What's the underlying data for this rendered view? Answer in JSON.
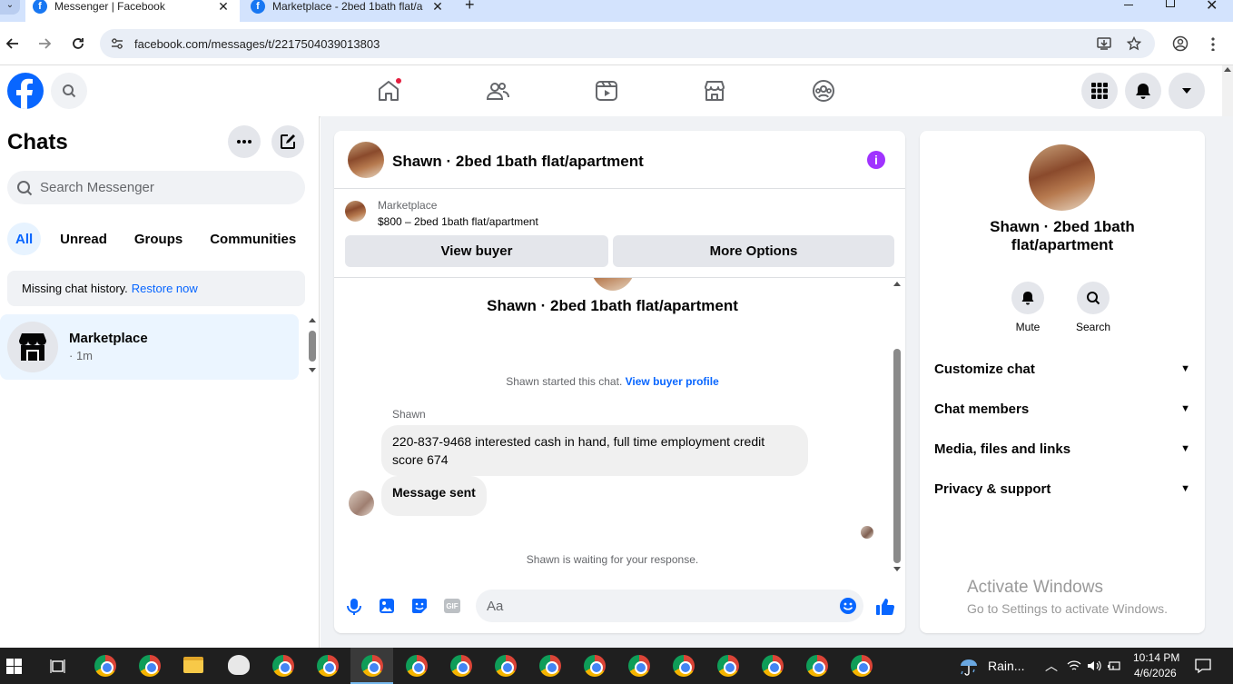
{
  "browser": {
    "tabs": [
      {
        "title": "Messenger | Facebook",
        "active": true
      },
      {
        "title": "Marketplace - 2bed 1bath flat/a",
        "active": false
      }
    ],
    "new_tab": "+",
    "url": "facebook.com/messages/t/2217504039013803"
  },
  "fb_header": {
    "nav_icons": [
      "home-icon",
      "friends-icon",
      "video-icon",
      "marketplace-icon",
      "groups-icon"
    ],
    "right_icons": [
      "menu-grid-icon",
      "notifications-icon",
      "account-caret-icon"
    ]
  },
  "sidebar": {
    "title": "Chats",
    "search_placeholder": "Search Messenger",
    "filters": [
      "All",
      "Unread",
      "Groups",
      "Communities"
    ],
    "notice_text": "Missing chat history.",
    "notice_link": "Restore now",
    "chats": [
      {
        "name": "Marketplace",
        "meta": "· 1m"
      }
    ]
  },
  "conversation": {
    "header_title": "Shawn · 2bed 1bath flat/apartment",
    "listing_source": "Marketplace",
    "listing_title": "$800 – 2bed 1bath flat/apartment",
    "view_buyer": "View buyer",
    "more_options": "More Options",
    "intro_title": "Shawn · 2bed 1bath flat/apartment",
    "started_text": "Shawn started this chat.",
    "view_profile_link": "View buyer profile",
    "sender_name": "Shawn",
    "messages": [
      "220-837-9468 interested cash in hand, full time employment credit score 674",
      "Message sent"
    ],
    "waiting_text": "Shawn is waiting for your response.",
    "input_placeholder": "Aa"
  },
  "info_panel": {
    "title": "Shawn · 2bed 1bath flat/apartment",
    "actions": [
      {
        "label": "Mute",
        "icon": "bell-icon"
      },
      {
        "label": "Search",
        "icon": "search-icon"
      }
    ],
    "sections": [
      "Customize chat",
      "Chat members",
      "Media, files and links",
      "Privacy & support"
    ],
    "watermark_title": "Activate Windows",
    "watermark_sub": "Go to Settings to activate Windows."
  },
  "taskbar": {
    "weather": "Rain...",
    "time": "10:14 PM",
    "date": "4/6/2026"
  },
  "colors": {
    "fb_blue": "#0866ff",
    "messenger_purple": "#a033ff",
    "tab_strip": "#d3e3fd"
  }
}
